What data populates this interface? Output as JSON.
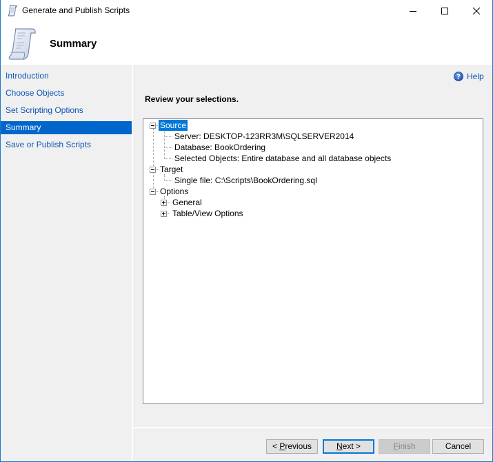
{
  "window": {
    "title": "Generate and Publish Scripts",
    "controls": {
      "minimize": "minimize-icon",
      "maximize": "maximize-icon",
      "close": "close-icon"
    },
    "border_color": "#1979ca"
  },
  "header": {
    "title": "Summary",
    "icon": "script-scroll-icon"
  },
  "sidebar": {
    "items": [
      {
        "label": "Introduction",
        "selected": false
      },
      {
        "label": "Choose Objects",
        "selected": false
      },
      {
        "label": "Set Scripting Options",
        "selected": false
      },
      {
        "label": "Summary",
        "selected": true
      },
      {
        "label": "Save or Publish Scripts",
        "selected": false
      }
    ],
    "selected_color": "#0066cc",
    "link_color": "#0e55b6"
  },
  "main": {
    "help_label": "Help",
    "instruction": "Review your selections.",
    "tree": [
      {
        "label": "Source",
        "expanded": true,
        "selected": true,
        "children": [
          {
            "label": "Server: DESKTOP-123RR3M\\SQLSERVER2014"
          },
          {
            "label": "Database: BookOrdering"
          },
          {
            "label": "Selected Objects: Entire database and all database objects"
          }
        ]
      },
      {
        "label": "Target",
        "expanded": true,
        "selected": false,
        "children": [
          {
            "label": "Single file: C:\\Scripts\\BookOrdering.sql"
          }
        ]
      },
      {
        "label": "Options",
        "expanded": true,
        "selected": false,
        "children": [
          {
            "label": "General",
            "expandable": true,
            "expanded": false
          },
          {
            "label": "Table/View Options",
            "expandable": true,
            "expanded": false
          }
        ]
      }
    ]
  },
  "footer": {
    "previous": {
      "prefix": "< ",
      "mnemonic": "P",
      "rest": "revious",
      "enabled": true
    },
    "next": {
      "prefix": "",
      "mnemonic": "N",
      "rest": "ext >",
      "enabled": true,
      "default": true
    },
    "finish": {
      "prefix": "",
      "mnemonic": "F",
      "rest": "inish",
      "enabled": false
    },
    "cancel": {
      "label": "Cancel",
      "enabled": true
    }
  }
}
